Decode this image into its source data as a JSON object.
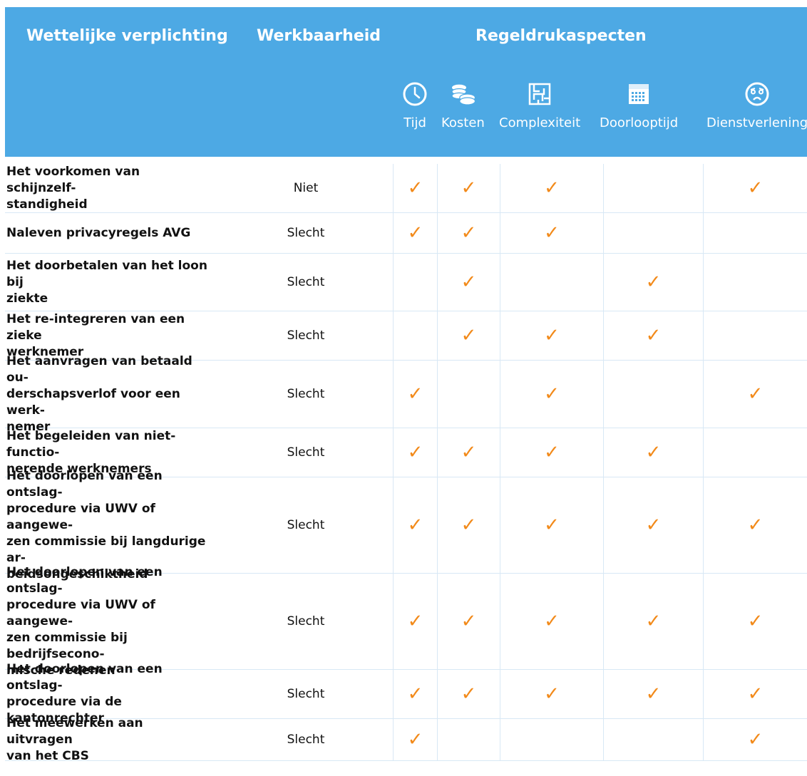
{
  "header": {
    "col_obligation": "Wettelijke verplichting",
    "col_workability": "Werkbaarheid",
    "col_aspects": "Regeldrukaspecten",
    "aspects": [
      {
        "label": "Tijd",
        "icon": "clock-icon"
      },
      {
        "label": "Kosten",
        "icon": "coins-icon"
      },
      {
        "label": "Complexiteit",
        "icon": "maze-icon"
      },
      {
        "label": "Doorlooptijd",
        "icon": "calendar-icon"
      },
      {
        "label": "Dienstverlening",
        "icon": "unhappy-face-icon"
      }
    ]
  },
  "colors": {
    "header_bg": "#4da9e4",
    "check": "#f28a1a"
  },
  "check_symbol": "✓",
  "rows": [
    {
      "obligation": "Het voorkomen van schijnzelf-standigheid",
      "lines": [
        "Het voorkomen van schijnzelf-",
        "standigheid"
      ],
      "workability": "Niet",
      "checks": [
        true,
        true,
        true,
        false,
        true
      ]
    },
    {
      "obligation": "Naleven privacyregels AVG",
      "lines": [
        "Naleven privacyregels AVG"
      ],
      "workability": "Slecht",
      "checks": [
        true,
        true,
        true,
        false,
        false
      ]
    },
    {
      "obligation": "Het doorbetalen van het loon bij ziekte",
      "lines": [
        "Het doorbetalen van het loon bij",
        "ziekte"
      ],
      "workability": "Slecht",
      "checks": [
        false,
        true,
        false,
        true,
        false
      ]
    },
    {
      "obligation": "Het re-integreren van een zieke werknemer",
      "lines": [
        "Het re-integreren van een zieke",
        "werknemer"
      ],
      "workability": "Slecht",
      "checks": [
        false,
        true,
        true,
        true,
        false
      ]
    },
    {
      "obligation": "Het aanvragen van betaald ouderschapsverlof voor een werknemer",
      "lines": [
        "Het aanvragen van betaald ou-",
        "derschapsverlof voor een werk-",
        "nemer"
      ],
      "workability": "Slecht",
      "checks": [
        true,
        false,
        true,
        false,
        true
      ]
    },
    {
      "obligation": "Het begeleiden van niet-functionerende werknemers",
      "lines": [
        "Het begeleiden van niet-functio-",
        "nerende werknemers"
      ],
      "workability": "Slecht",
      "checks": [
        true,
        true,
        true,
        true,
        false
      ]
    },
    {
      "obligation": "Het doorlopen van een ontslagprocedure via UWV of aangewezen commissie bij langdurige arbeidsongeschiktheid",
      "lines": [
        "Het doorlopen van een ontslag-",
        "procedure via UWV of aangewe-",
        "zen commissie bij langdurige ar-",
        "beidsongeschiktheid"
      ],
      "workability": "Slecht",
      "checks": [
        true,
        true,
        true,
        true,
        true
      ]
    },
    {
      "obligation": "Het doorlopen van een ontslagprocedure via UWV of aangewezen commissie bij bedrijfseconomische redenen",
      "lines": [
        "Het doorlopen van een ontslag-",
        "procedure via UWV of aangewe-",
        "zen commissie bij bedrijfsecono-",
        "mische redenen"
      ],
      "workability": "Slecht",
      "checks": [
        true,
        true,
        true,
        true,
        true
      ]
    },
    {
      "obligation": "Het doorlopen van een ontslagprocedure via de kantonrechter",
      "lines": [
        "Het doorlopen van een ontslag-",
        "procedure via de kantonrechter"
      ],
      "workability": "Slecht",
      "checks": [
        true,
        true,
        true,
        true,
        true
      ]
    },
    {
      "obligation": "Het meewerken aan uitvragen van het CBS",
      "lines": [
        "Het meewerken aan uitvragen",
        "van het CBS"
      ],
      "workability": "Slecht",
      "checks": [
        true,
        false,
        false,
        false,
        true
      ]
    }
  ]
}
